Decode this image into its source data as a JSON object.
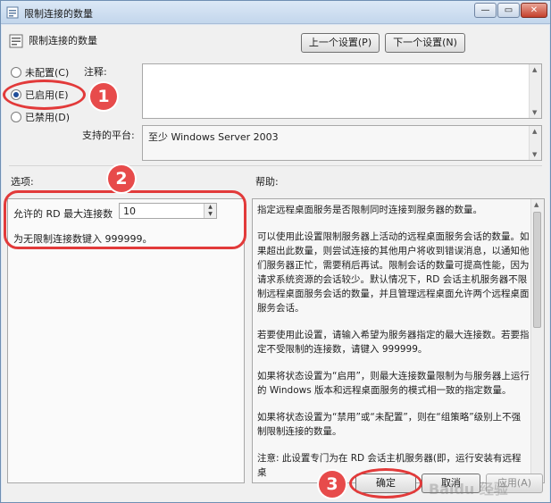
{
  "window": {
    "title": "限制连接的数量",
    "controls": {
      "minimize": "—",
      "maximize": "▭",
      "close": "✕"
    }
  },
  "header": {
    "title": "限制连接的数量"
  },
  "nav": {
    "prev_label": "上一个设置(P)",
    "next_label": "下一个设置(N)"
  },
  "state": {
    "options": [
      {
        "label": "未配置(C)",
        "checked": false
      },
      {
        "label": "已启用(E)",
        "checked": true
      },
      {
        "label": "已禁用(D)",
        "checked": false
      }
    ]
  },
  "comment": {
    "label": "注释:",
    "value": ""
  },
  "platform": {
    "label": "支持的平台:",
    "value": "至少 Windows Server 2003"
  },
  "options_panel": {
    "heading": "选项:",
    "max_label": "允许的 RD 最大连接数",
    "max_value": "10",
    "hint": "为无限制连接数键入 999999。"
  },
  "help": {
    "heading": "帮助:",
    "paragraphs": [
      "指定远程桌面服务是否限制同时连接到服务器的数量。",
      "可以使用此设置限制服务器上活动的远程桌面服务会话的数量。如果超出此数量，则尝试连接的其他用户将收到错误消息，以通知他们服务器正忙，需要稍后再试。限制会话的数量可提高性能，因为请求系统资源的会话较少。默认情况下，RD 会话主机服务器不限制远程桌面服务会话的数量，并且管理远程桌面允许两个远程桌面服务会话。",
      "若要使用此设置，请输入希望为服务器指定的最大连接数。若要指定不受限制的连接数，请键入 999999。",
      "如果将状态设置为“启用”，则最大连接数量限制为与服务器上运行的 Windows 版本和远程桌面服务的模式相一致的指定数量。",
      "如果将状态设置为“禁用”或“未配置”，则在“组策略”级别上不强制限制连接的数量。",
      "注意: 此设置专门为在 RD 会话主机服务器(即，运行安装有远程桌"
    ]
  },
  "footer": {
    "ok": "确定",
    "cancel": "取消",
    "apply": "应用(A)"
  },
  "annotations": {
    "one": "1",
    "two": "2",
    "three": "3"
  },
  "watermark": "Baidu 经验",
  "colors": {
    "annotation": "#e23a3a",
    "badge": "#e74b4b",
    "title_bar": "#c3d6ec"
  }
}
